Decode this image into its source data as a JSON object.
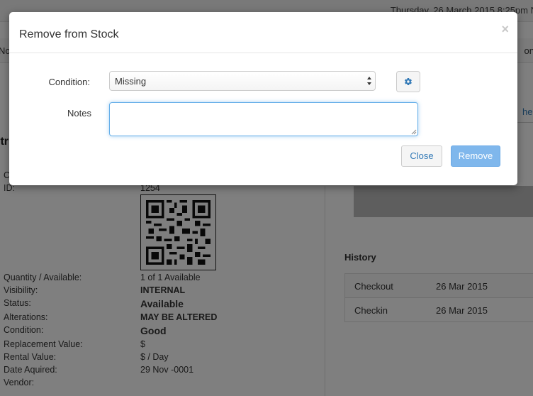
{
  "background": {
    "datetime": "Thursday, 26 March 2015 8:25pm N",
    "nav_left": "No",
    "nav_right": "on",
    "link_partial": "hec",
    "heading_partial": "ltr",
    "fields": [
      {
        "label": "C",
        "value": ""
      },
      {
        "label": "ID:",
        "value": "1254"
      },
      {
        "label": "Quantity / Available:",
        "value": "1 of 1 Available"
      },
      {
        "label": "Visibility:",
        "value": "INTERNAL"
      },
      {
        "label": "Status:",
        "value": "Available"
      },
      {
        "label": "Alterations:",
        "value": "MAY BE ALTERED"
      },
      {
        "label": "Condition:",
        "value": "Good"
      },
      {
        "label": "Replacement Value:",
        "value": "$"
      },
      {
        "label": "Rental Value:",
        "value": "$ / Day"
      },
      {
        "label": "Date Aquired:",
        "value": "29 Nov -0001"
      },
      {
        "label": "Vendor:",
        "value": ""
      }
    ],
    "qr_code_icon": "qr-code-icon",
    "history": {
      "title": "History",
      "rows": [
        {
          "action": "Checkout",
          "date": "26 Mar 2015"
        },
        {
          "action": "Checkin",
          "date": "26 Mar 2015"
        }
      ]
    }
  },
  "modal": {
    "title": "Remove from Stock",
    "close_symbol": "×",
    "condition_label": "Condition:",
    "condition_value": "Missing",
    "settings_icon": "gear-icon",
    "notes_label": "Notes",
    "notes_value": "",
    "close_button": "Close",
    "remove_button": "Remove",
    "accent_color": "#7fb7ec"
  }
}
